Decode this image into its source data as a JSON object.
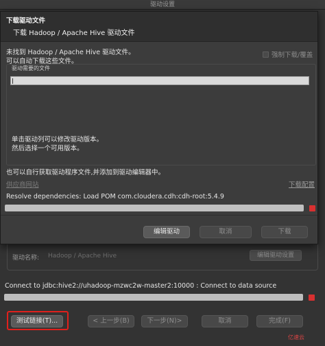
{
  "background_window": {
    "title": "驱动设置",
    "driver_name_label": "驱动名称:",
    "driver_name_value": "Hadoop / Apache Hive",
    "edit_driver_settings_label": "编辑驱动设置",
    "connect_status": "Connect to jdbc:hive2://uhadoop-mzwc2w-master2:10000 : Connect to data source",
    "buttons": {
      "test_connection": "测试链接(T)...",
      "previous": "< 上一步(B)",
      "next": "下一步(N)>",
      "cancel": "取消",
      "finish": "完成(F)"
    }
  },
  "modal": {
    "title": "下载驱动文件",
    "subtitle": "下载 Hadoop / Apache Hive 驱动文件",
    "missing_line1": "未找到 Hadoop / Apache Hive 驱动文件。",
    "missing_line2": "可以自动下载这些文件。",
    "force_download_label": "强制下载/覆盖",
    "force_download_checked": false,
    "needed_files_label": "驱动需要的文件",
    "hint_line1": "单击驱动列可以修改驱动版本。",
    "hint_line2": "然后选择一个可用版本。",
    "manual_note": "也可以自行获取驱动程序文件,并添加到驱动编辑器中。",
    "vendor_site_link": "供应商网站",
    "download_config_link": "下载配置",
    "resolve_status": "Resolve dependencies: Load POM com.cloudera.cdh:cdh-root:5.4.9",
    "buttons": {
      "edit_driver": "编辑驱动",
      "cancel": "取消",
      "download": "下载"
    }
  },
  "watermark": "亿速云",
  "colors": {
    "stop_button": "#d83030",
    "highlight_box": "#e0201c"
  }
}
